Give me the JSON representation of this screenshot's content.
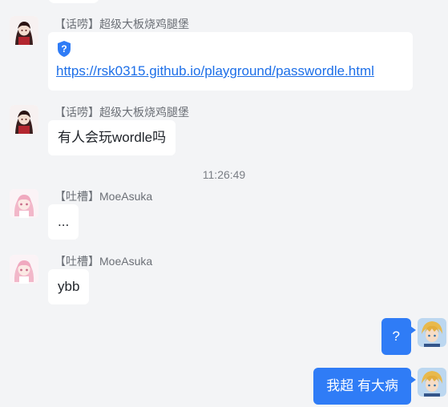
{
  "messages": [
    {
      "sender": "【话唠】超级大板烧鸡腿堡",
      "link": "https://rsk0315.github.io/playground/passwordle.html"
    },
    {
      "sender": "【话唠】超级大板烧鸡腿堡",
      "text": "有人会玩wordle吗"
    },
    {
      "sender": "【吐槽】MoeAsuka",
      "text": "..."
    },
    {
      "sender": "【吐槽】MoeAsuka",
      "text": "ybb"
    },
    {
      "text": "?"
    },
    {
      "text": "我超 有大病"
    }
  ],
  "timestamp": "11:26:49",
  "icons": {
    "link_icon": "question-shield-icon"
  },
  "colors": {
    "background": "#f3f4f6",
    "bubble_other": "#ffffff",
    "bubble_self": "#2f7cf6",
    "link": "#1d6fe8"
  }
}
